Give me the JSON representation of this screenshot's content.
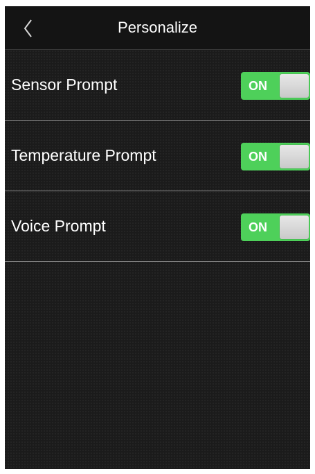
{
  "header": {
    "title": "Personalize",
    "back_icon": "chevron-left-icon"
  },
  "settings": [
    {
      "label": "Sensor Prompt",
      "toggle_text": "ON",
      "enabled": true
    },
    {
      "label": "Temperature Prompt",
      "toggle_text": "ON",
      "enabled": true
    },
    {
      "label": "Voice Prompt",
      "toggle_text": "ON",
      "enabled": true
    }
  ],
  "colors": {
    "toggle_on": "#4ed05a",
    "background": "#1b1b1b",
    "divider": "#8c8c8c"
  }
}
